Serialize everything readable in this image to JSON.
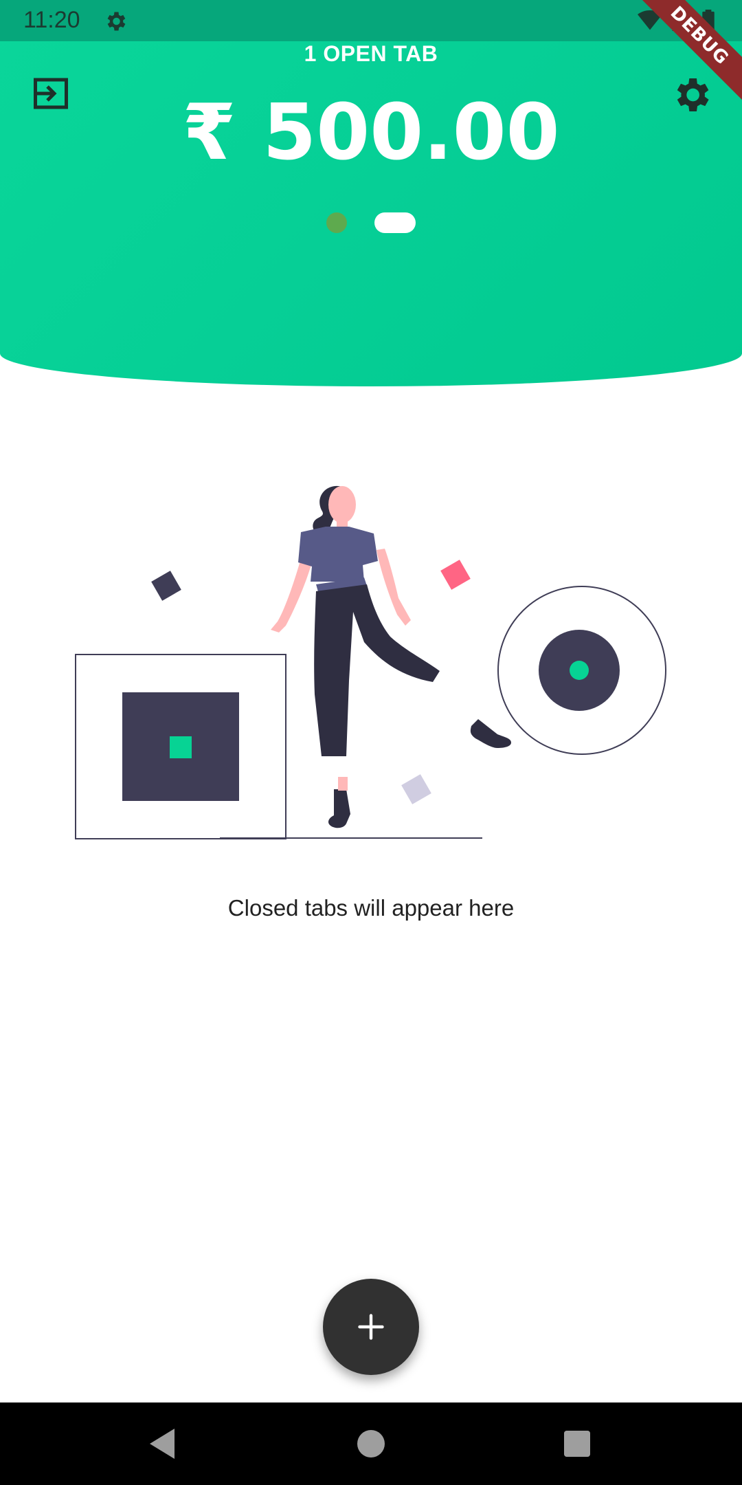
{
  "status_bar": {
    "time": "11:20",
    "icons": [
      "settings-icon",
      "wifi-icon",
      "signal-icon",
      "battery-icon"
    ]
  },
  "debug_banner": "DEBUG",
  "header": {
    "open_tabs_label": "1 OPEN TAB",
    "amount": "₹ 500.00",
    "gradient_start": "#0ad69a",
    "gradient_end": "#02c98f",
    "pager": {
      "pages": 2,
      "active_index": 1
    }
  },
  "main": {
    "empty_state_text": "Closed tabs will appear here"
  },
  "fab": {
    "icon": "plus-icon"
  },
  "nav_bar": {
    "buttons": [
      "back-icon",
      "home-icon",
      "recents-icon"
    ]
  }
}
